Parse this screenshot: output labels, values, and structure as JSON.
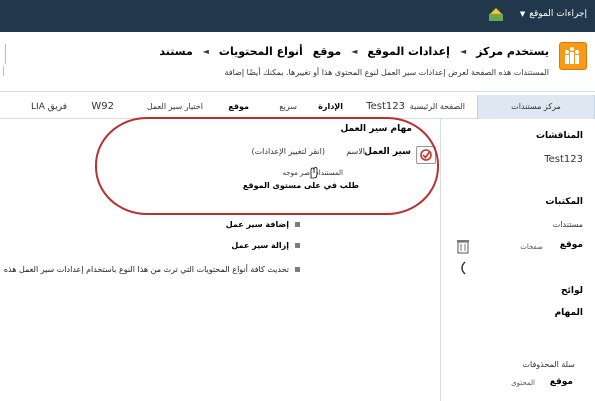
{
  "topbar": {
    "site_actions_label": "إجراءات الموقع",
    "caret": "▼"
  },
  "ribbon": {
    "breadcrumb": [
      "يستخدم مركز",
      "إعدادات الموقع",
      "موقع",
      "أنواع المحتويات",
      "مستند"
    ],
    "separators": [
      "◄",
      "◄",
      "◄"
    ],
    "subtitle": "المستندات هذه الصفحة لعرض إعدادات سير العمل لنوع المحتوى هذا أو تغييرها. يمكنك أيضًا إضافة"
  },
  "topnav": {
    "items": [
      "مركز مستندات",
      "الصفحة الرئيسية",
      "Test123",
      "الإدارة",
      "سريع",
      "موقع",
      "اختيار سير العمل",
      "W92",
      "فريق LIA"
    ]
  },
  "quick_launch": {
    "h1": "المناقشات",
    "i1": "Test123",
    "h2": "المكتبات",
    "i2": "مستندات",
    "h3": "موقع",
    "sub3": "صفحات",
    "h4": "لوائح",
    "h5": "المهام",
    "h6": "سلة المحذوفات",
    "h7": "موقع",
    "sub7": "المحتوى"
  },
  "main": {
    "section_title": "مهام سير العمل",
    "wf_label": "سير العمل",
    "wf_name_col": "الاسم",
    "wf_desc": "(انقر لتغيير الإعدادات)",
    "row_small": "المستندات صر      موجه",
    "row_bold": "طلب في على مستوى الموقع",
    "links": [
      {
        "label": "إضافة سير عمل",
        "bold": true
      },
      {
        "label": "إزالة سير عمل",
        "bold": true
      },
      {
        "label": "تحديث كافة أنواع المحتويات التي ترث من هذا النوع باستخدام إعدادات سير العمل هذه",
        "bold": false
      }
    ]
  },
  "colors": {
    "topbar": "#21374c",
    "accent": "#f79a17",
    "highlight_circle": "#b83131"
  }
}
